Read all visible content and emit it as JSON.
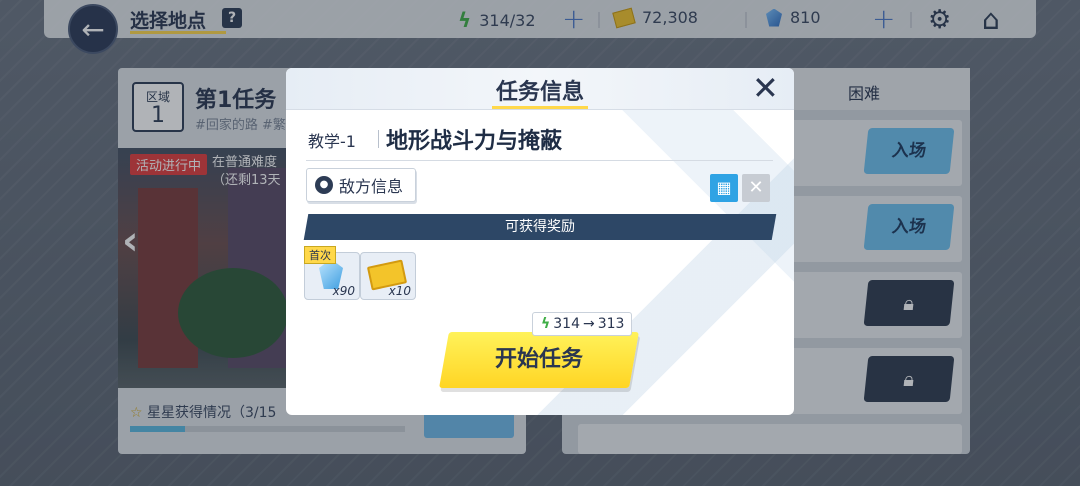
{
  "topbar": {
    "title": "选择地点",
    "help": "?",
    "stamina": "314/32",
    "credits": "72,308",
    "gems": "810"
  },
  "mission": {
    "zone_label": "区域",
    "zone_number": "1",
    "title": "第1任务",
    "tags": "#回家的路 #繁",
    "event_badge": "活动进行中",
    "event_line1": "在普通难度",
    "event_line2": "（还剩13天",
    "stars_text": "星星获得情况（3/15",
    "stars_progress": 0.2
  },
  "stages": {
    "difficulty_label": "困难",
    "enter_label": "入场"
  },
  "modal": {
    "title": "任务信息",
    "close_glyph": "✕",
    "stage_code": "教学-1",
    "stage_name": "地形战斗力与掩蔽",
    "enemy_info": "敌方信息",
    "rewards_banner": "可获得奖励",
    "first_clear_tag": "首次",
    "reward_items": [
      {
        "icon": "crystal-icon",
        "qty": "x90"
      },
      {
        "icon": "ticket-icon",
        "qty": "x10"
      }
    ],
    "cost_from": "314",
    "cost_arrow": "→",
    "cost_to": "313",
    "start_button": "开始任务"
  },
  "colors": {
    "accent_yellow": "#ffd84a",
    "dark_navy": "#2d3c55",
    "enter_blue": "#6dc0ee",
    "event_red": "#e23d3d"
  }
}
